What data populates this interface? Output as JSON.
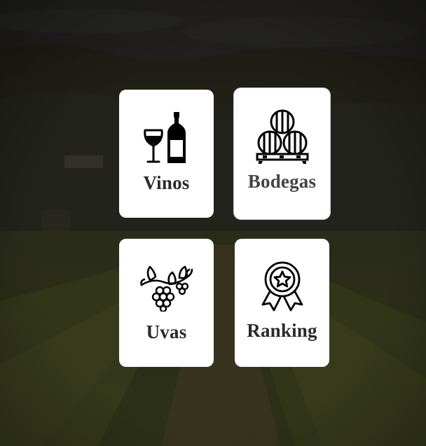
{
  "menu": {
    "items": [
      {
        "key": "vinos",
        "label": "Vinos",
        "icon": "wine-glass-bottle-icon"
      },
      {
        "key": "bodegas",
        "label": "Bodegas",
        "icon": "wine-barrels-icon"
      },
      {
        "key": "uvas",
        "label": "Uvas",
        "icon": "grapes-vine-icon"
      },
      {
        "key": "ranking",
        "label": "Ranking",
        "icon": "award-ribbon-icon"
      }
    ]
  },
  "colors": {
    "card_background": "#ffffff",
    "label_text": "#2b2b2b",
    "overlay": "#16150f"
  }
}
